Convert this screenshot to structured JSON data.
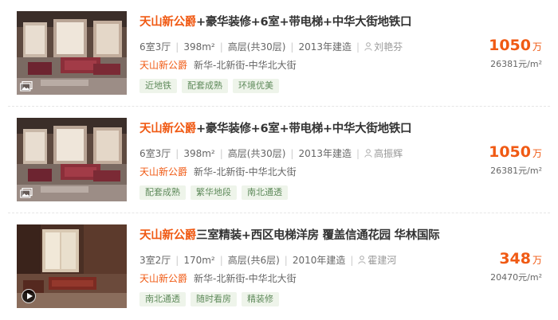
{
  "listings": [
    {
      "title_highlight": "天山新公爵",
      "title_rest": "+豪华装修+6室+带电梯+中华大街地铁口",
      "layout": "6室3厅",
      "area": "398m²",
      "floor": "高层(共30层)",
      "built": "2013年建造",
      "agent": "刘艳芬",
      "community": "天山新公爵",
      "location": "新华-北新街-中华北大街",
      "tags": [
        "近地铁",
        "配套成熟",
        "环境优美"
      ],
      "price": "1050",
      "price_unit": "万",
      "unit_price": "26381元/m²",
      "media_icon": "album-icon"
    },
    {
      "title_highlight": "天山新公爵",
      "title_rest": "+豪华装修+6室+带电梯+中华大街地铁口",
      "layout": "6室3厅",
      "area": "398m²",
      "floor": "高层(共30层)",
      "built": "2013年建造",
      "agent": "高振辉",
      "community": "天山新公爵",
      "location": "新华-北新街-中华北大街",
      "tags": [
        "配套成熟",
        "繁华地段",
        "南北通透"
      ],
      "price": "1050",
      "price_unit": "万",
      "unit_price": "26381元/m²",
      "media_icon": "album-icon"
    },
    {
      "title_highlight": "天山新公爵",
      "title_rest": "三室精装+西区电梯洋房 覆盖信通花园 华林国际",
      "layout": "3室2厅",
      "area": "170m²",
      "floor": "高层(共6层)",
      "built": "2010年建造",
      "agent": "霍建河",
      "community": "天山新公爵",
      "location": "新华-北新街-中华北大街",
      "tags": [
        "南北通透",
        "随时看房",
        "精装修"
      ],
      "price": "348",
      "price_unit": "万",
      "unit_price": "20470元/m²",
      "media_icon": "video-play-icon"
    }
  ],
  "colors": {
    "accent": "#f05a14",
    "tag_text": "#5f8a5b",
    "tag_bg": "#eef4ea"
  }
}
